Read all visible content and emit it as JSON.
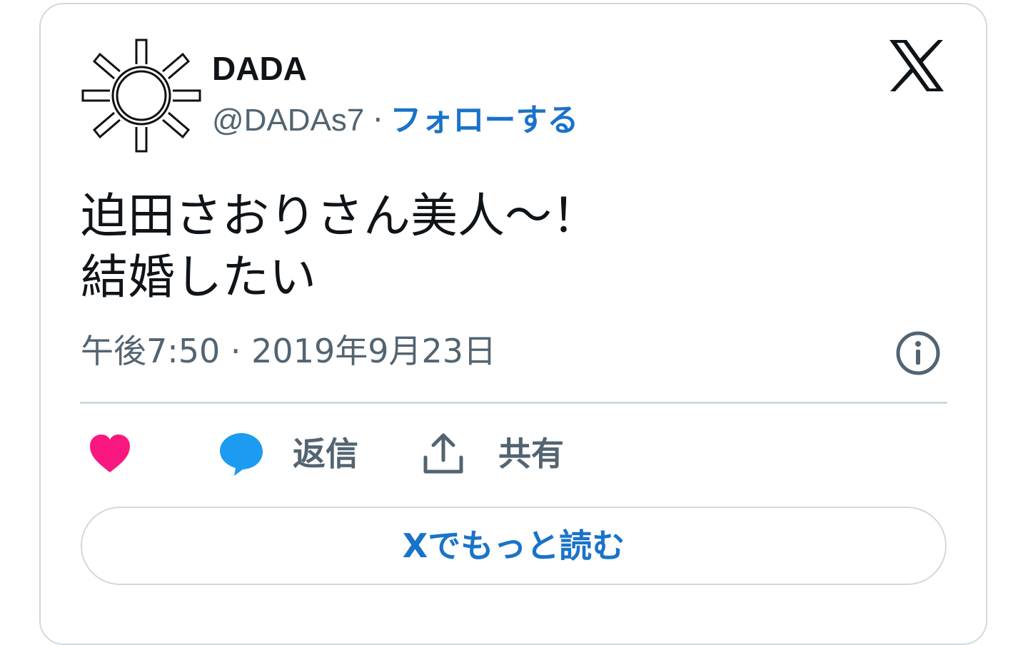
{
  "user": {
    "display_name": "DADA",
    "handle": "@DADAs7",
    "separator": "·",
    "follow_label": "フォローする"
  },
  "tweet": {
    "text": "迫田さおりさん美人〜！\n結婚したい",
    "timestamp": "午後7:50 · 2019年9月23日"
  },
  "actions": {
    "reply_label": "返信",
    "share_label": "共有"
  },
  "read_more_label": "Xでもっと読む",
  "icons": {
    "avatar": "sun-gear-icon",
    "brand": "x-logo-icon",
    "info": "info-icon",
    "like": "heart-icon",
    "reply": "speech-bubble-icon",
    "share": "share-upload-icon"
  },
  "colors": {
    "accent": "#1a73c9",
    "like": "#f91880",
    "reply": "#1d9bf0",
    "text": "#0f1419",
    "secondary": "#536471",
    "border": "#cfd9de"
  }
}
